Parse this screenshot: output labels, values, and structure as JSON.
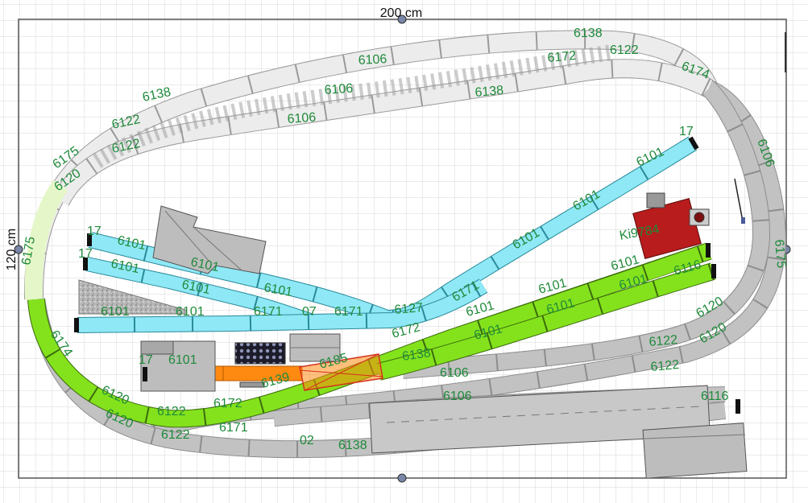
{
  "dimensions": {
    "width_label": "200 cm",
    "height_label": "120 cm"
  },
  "colors": {
    "grid": "#d7d7d7",
    "gray_track": "#bfbfbf",
    "light_track": "#ececec",
    "cyan_track": "#8fe8f5",
    "green_track": "#84e21c",
    "orange_track": "#ff8a12",
    "label": "#1f8a3a"
  },
  "labels": {
    "t6138_top": "6138",
    "t6106_top": "6106",
    "t6172_top": "6172",
    "t6122_top": "6122",
    "t6174_top": "6174",
    "t6106_mid": "6106",
    "t6138_mid": "6138",
    "t6138_left": "6138",
    "t6122_left1": "6122",
    "t6106_lower": "6106",
    "t6122_left2": "6122",
    "t6175_left": "6175",
    "t6120_left": "6120",
    "t6175_bottomleft": "6175",
    "t6106_right": "6106",
    "t6175_right": "6175",
    "t17_top": "17",
    "t6101_c1": "6101",
    "t6101_c2": "6101",
    "t6101_c3": "6101",
    "t17_s1": "17",
    "t6101_s1": "6101",
    "t17_s2": "17",
    "t6101_s2": "6101",
    "t6101_s2b": "6101",
    "t6101_s3": "6101",
    "t6101_s3b": "6101",
    "t6171_s3": "6171",
    "t07_s3": "07",
    "t6171_s3b": "6171",
    "t6101_s4": "6101",
    "t6101_s4b": "6101",
    "t6127": "6127",
    "t6171_mid": "6171",
    "t6101_g1": "6101",
    "t6101_g2": "6101",
    "t6101_g3": "6101",
    "t6101_g4": "6101",
    "t6101_g5": "6101",
    "t6101_g6": "6101",
    "t6116_g": "6116",
    "t6172_mid": "6172",
    "t6138_mid2": "6138",
    "t6185": "6185",
    "t6139": "6139",
    "t6106_b1": "6106",
    "t6106_b2": "6106",
    "t17_orange": "17",
    "t6101_orange": "6101",
    "t6174_left": "6174",
    "t6120_bl1": "6120",
    "t6120_bl2": "6120",
    "t6122_b1": "6122",
    "t6122_b2": "6122",
    "t6172_b": "6172",
    "t6171_b": "6171",
    "t02_b": "02",
    "t6138_b": "6138",
    "t6122_r1": "6122",
    "t6122_r2": "6122",
    "t6120_r1": "6120",
    "t6120_r2": "6120",
    "t6116_r": "6116",
    "ki9784": "Ki9784"
  }
}
